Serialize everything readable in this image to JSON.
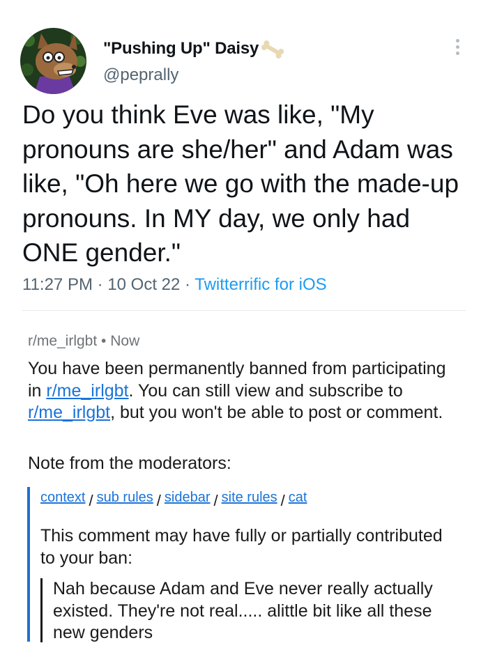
{
  "tweet": {
    "display_name": "\"Pushing Up\" Daisy",
    "handle": "@peprally",
    "text": "Do you think Eve was like, \"My pronouns are she/her\" and Adam was like, \"Oh here we go with the made-up pronouns. In MY day, we only had ONE gender.\"",
    "time": "11:27 PM",
    "date": "10 Oct 22",
    "source": "Twitterrific for iOS",
    "separator": "·",
    "avatar_icon": "wolf-avatar-icon",
    "badge_icon": "bone-icon",
    "menu_icon": "more-vertical-icon",
    "colors": {
      "text": "#0f1419",
      "secondary": "#536471",
      "link": "#1d9bf0"
    }
  },
  "reddit": {
    "subreddit": "r/me_irlgbt",
    "bullet": "•",
    "time": "Now",
    "ban_message": {
      "part1": "You have been permanently banned from participating in ",
      "link1": "r/me_irlgbt",
      "part2": ". You can still view and subscribe to ",
      "link2": "r/me_irlgbt",
      "part3": ", but you won't be able to post or comment."
    },
    "mod_note_label": "Note from the moderators:",
    "mod_links": [
      "context",
      "sub rules",
      "sidebar",
      "site rules",
      "cat"
    ],
    "link_separator": "/",
    "contrib_text": "This comment may have fully or partially contributed to your ban:",
    "quoted_comment": "Nah because Adam and Eve never really actually existed. They're not real..... alittle bit like all these new genders",
    "colors": {
      "text": "#1a1a1b",
      "link": "#1a73d9",
      "quote_bar": "#1f6fd1"
    }
  }
}
